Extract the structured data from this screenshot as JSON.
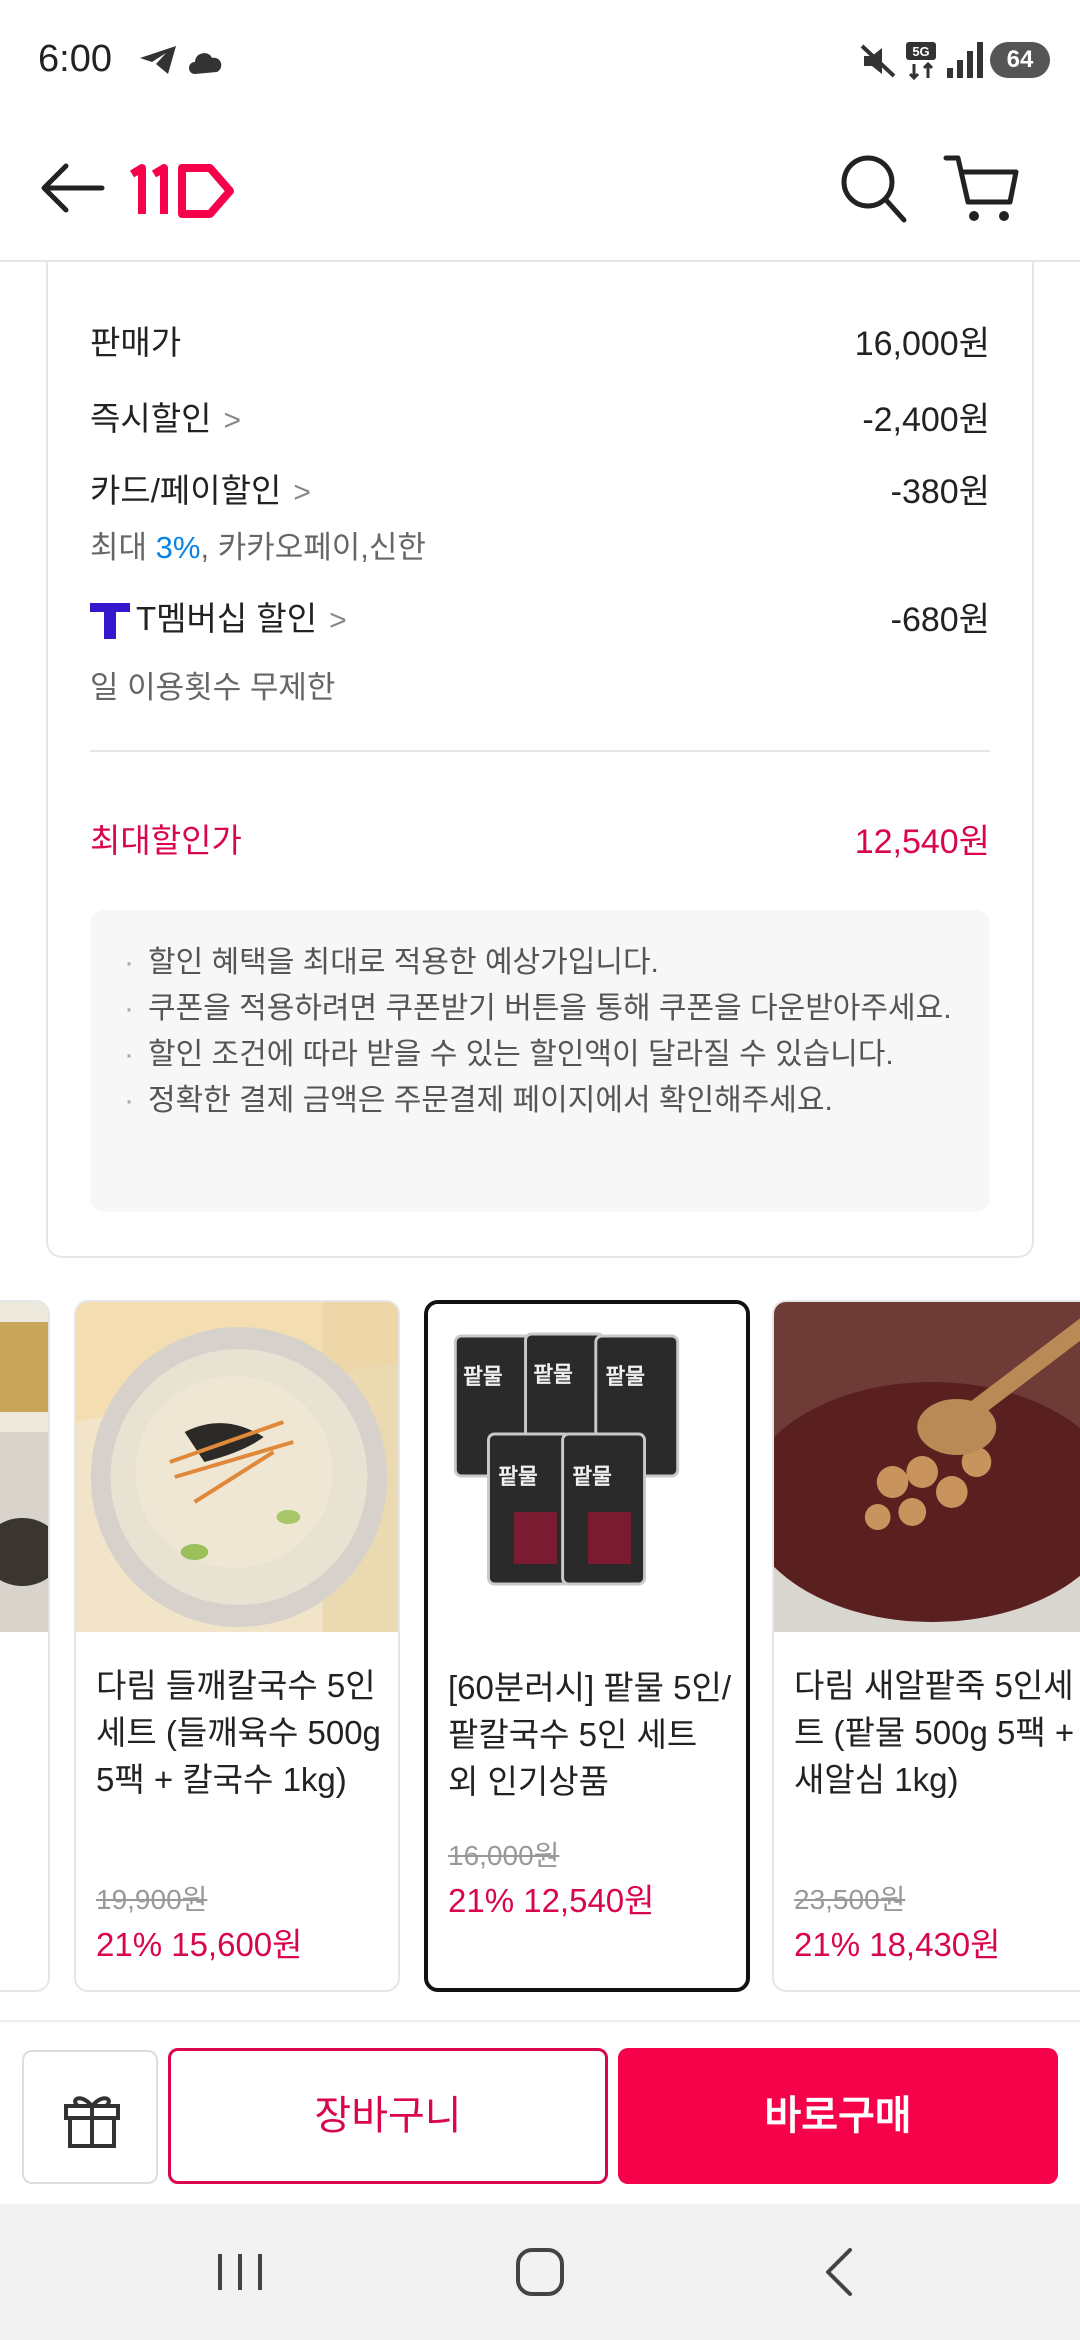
{
  "status_bar": {
    "time": "6:00",
    "battery": "64",
    "icons": [
      "telegram-icon",
      "cloud-icon",
      "mute-icon",
      "5g-icon",
      "signal-icon",
      "battery-icon"
    ]
  },
  "header": {
    "logo_text": "11번가",
    "icons": [
      "back-arrow-icon",
      "search-icon",
      "cart-icon"
    ],
    "brand_color": "#f5024a"
  },
  "price_panel": {
    "sale_price": {
      "label": "판매가",
      "value": "16,000원"
    },
    "instant_discount": {
      "label": "즉시할인",
      "value": "-2,400원"
    },
    "card_discount": {
      "label": "카드/페이할인",
      "value": "-380원",
      "sub_prefix": "최대 ",
      "sub_percent": "3%",
      "sub_suffix": ", 카카오페이,신한"
    },
    "membership_discount": {
      "label": "T멤버십 할인",
      "value": "-680원",
      "sub": "일 이용횟수 무제한"
    },
    "max_discount": {
      "label": "최대할인가",
      "value": "12,540원"
    },
    "notices": [
      "할인 혜택을 최대로 적용한 예상가입니다.",
      "쿠폰을 적용하려면 쿠폰받기 버튼을 통해 쿠폰을 다운받아주세요.",
      "할인 조건에 따라 받을 수 있는 할인액이 달라질 수 있습니다.",
      "정확한 결제 금액은 주문결제 페이지에서 확인해주세요."
    ]
  },
  "carousel": {
    "items": [
      {
        "name": "다림 들깨칼국수 5인세트 (들깨육수 500g 5팩 + 칼국수 1kg)",
        "original_price": "19,900원",
        "discount": "21% 15,600원"
      },
      {
        "name": "[60분러시] 팥물 5인/팥칼국수 5인 세트 외 인기상품",
        "original_price": "16,000원",
        "discount": "21% 12,540원",
        "selected": true,
        "package_label": "팥물"
      },
      {
        "name": "다림 새알팥죽 5인세트 (팥물 500g 5팩 + 새알심 1kg)",
        "original_price": "23,500원",
        "discount": "21% 18,430원"
      }
    ]
  },
  "action_bar": {
    "cart_label": "장바구니",
    "buy_label": "바로구매",
    "icons": [
      "gift-icon"
    ],
    "accent": "#d9064a"
  },
  "nav_bar": {
    "icons": [
      "recent-apps-icon",
      "home-icon",
      "back-icon"
    ]
  }
}
